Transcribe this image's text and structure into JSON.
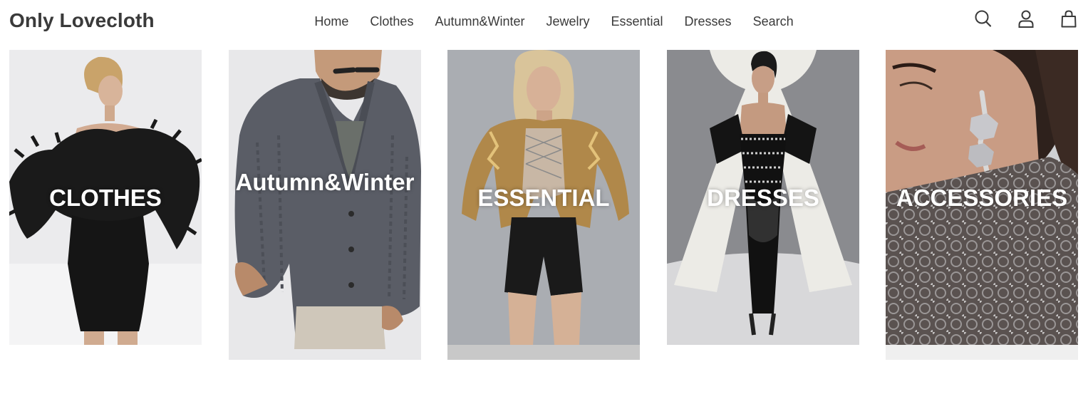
{
  "header": {
    "logo": "Only Lovecloth",
    "nav": [
      "Home",
      "Clothes",
      "Autumn&Winter",
      "Jewelry",
      "Essential",
      "Dresses",
      "Search"
    ],
    "icons": [
      "search-icon",
      "account-icon",
      "cart-icon"
    ]
  },
  "categories": [
    {
      "label": "CLOTHES"
    },
    {
      "label": "Autumn&Winter"
    },
    {
      "label": "ESSENTIAL"
    },
    {
      "label": "DRESSES"
    },
    {
      "label": "ACCESSORIES"
    }
  ],
  "colors": {
    "text": "#3a3a3a",
    "overlay_text": "#ffffff"
  }
}
